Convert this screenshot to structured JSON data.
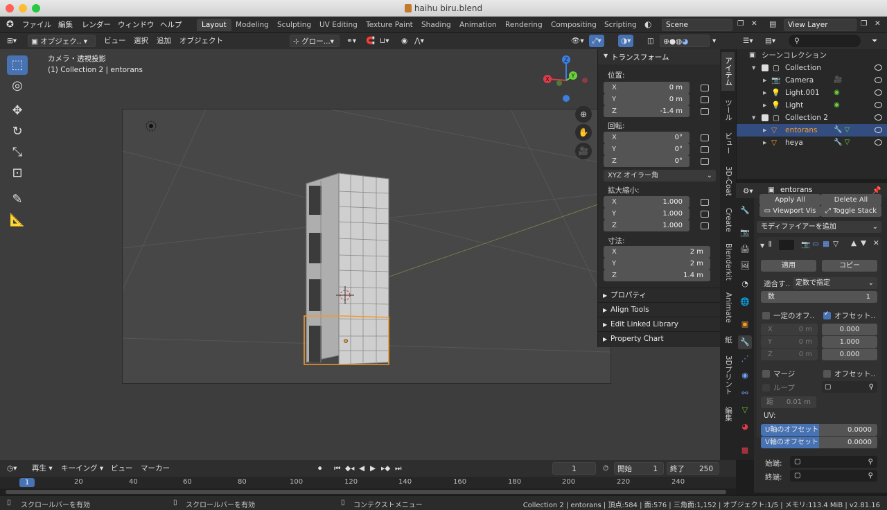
{
  "window": {
    "title": "haihu biru.blend"
  },
  "menu": [
    "ファイル",
    "編集",
    "レンダー",
    "ウィンドウ",
    "ヘルプ"
  ],
  "workspaces": [
    "Layout",
    "Modeling",
    "Sculpting",
    "UV Editing",
    "Texture Paint",
    "Shading",
    "Animation",
    "Rendering",
    "Compositing",
    "Scripting"
  ],
  "scene": {
    "label": "Scene"
  },
  "view_layer": {
    "label": "View Layer"
  },
  "viewport_header": {
    "mode": "オブジェク..",
    "view": "ビュー",
    "select": "選択",
    "add": "追加",
    "object": "オブジェクト",
    "orientation": "グロー..."
  },
  "viewport": {
    "view_name": "カメラ・透視投影",
    "collection_info": "(1) Collection 2 | entorans"
  },
  "gizmo": {
    "x": "X",
    "y": "Y",
    "z": "Z"
  },
  "transform": {
    "title": "トランスフォーム",
    "location_label": "位置:",
    "location": [
      {
        "axis": "X",
        "value": "0 m"
      },
      {
        "axis": "Y",
        "value": "0 m"
      },
      {
        "axis": "Z",
        "value": "-1.4 m"
      }
    ],
    "rotation_label": "回転:",
    "rotation": [
      {
        "axis": "X",
        "value": "0°"
      },
      {
        "axis": "Y",
        "value": "0°"
      },
      {
        "axis": "Z",
        "value": "0°"
      }
    ],
    "rotation_mode": "XYZ オイラー角",
    "scale_label": "拡大縮小:",
    "scale": [
      {
        "axis": "X",
        "value": "1.000"
      },
      {
        "axis": "Y",
        "value": "1.000"
      },
      {
        "axis": "Z",
        "value": "1.000"
      }
    ],
    "dimensions_label": "寸法:",
    "dimensions": [
      {
        "axis": "X",
        "value": "2 m"
      },
      {
        "axis": "Y",
        "value": "2 m"
      },
      {
        "axis": "Z",
        "value": "1.4 m"
      }
    ]
  },
  "npanel_sections": [
    "プロパティ",
    "Align Tools",
    "Edit Linked Library",
    "Property Chart"
  ],
  "npanel_tabs": [
    "アイテム",
    "ツール",
    "ビュー",
    "3D-Coat",
    "Create",
    "Blenderkit",
    "Animate",
    "紙",
    "3Dプリント",
    "編集"
  ],
  "outliner": {
    "root": "シーンコレクション",
    "rows": [
      {
        "name": "Collection",
        "indent": 1,
        "type": "collection"
      },
      {
        "name": "Camera",
        "indent": 2,
        "type": "camera"
      },
      {
        "name": "Light.001",
        "indent": 2,
        "type": "light"
      },
      {
        "name": "Light",
        "indent": 2,
        "type": "light"
      },
      {
        "name": "Collection 2",
        "indent": 1,
        "type": "collection"
      },
      {
        "name": "entorans",
        "indent": 2,
        "type": "mesh",
        "selected": true
      },
      {
        "name": "heya",
        "indent": 2,
        "type": "mesh"
      }
    ]
  },
  "properties": {
    "object_name": "entorans",
    "apply_all": "Apply All",
    "delete_all": "Delete All",
    "viewport_vis": "Viewport Vis",
    "toggle_stack": "Toggle Stack",
    "add_modifier": "モディファイアーを追加",
    "apply": "適用",
    "copy": "コピー",
    "fit_label": "適合す..",
    "fit_value": "定数で指定",
    "count_label": "数",
    "count_value": "1",
    "constant_offset": "一定のオフ..",
    "relative_offset": "オフセット..",
    "const_xyz": [
      {
        "axis": "X",
        "value": "0 m"
      },
      {
        "axis": "Y",
        "value": "0 m"
      },
      {
        "axis": "Z",
        "value": "0 m"
      }
    ],
    "rel_values": [
      "0.000",
      "1.000",
      "0.000"
    ],
    "merge": "マージ",
    "object_offset": "オフセット..",
    "loop": "ループ",
    "distance_label": "距",
    "distance_value": "0.01 m",
    "uv_label": "UV:",
    "u_offset_label": "U軸のオフセット",
    "u_offset_value": "0.0000",
    "v_offset_label": "V軸のオフセット",
    "v_offset_value": "0.0000",
    "start_cap": "始端:",
    "end_cap": "終端:"
  },
  "timeline": {
    "playback": "再生",
    "keying": "キーイング",
    "view": "ビュー",
    "marker": "マーカー",
    "current_frame": "1",
    "start_label": "開始",
    "start": "1",
    "end_label": "終了",
    "end": "250",
    "ruler": [
      "1",
      "20",
      "40",
      "60",
      "80",
      "100",
      "120",
      "140",
      "160",
      "180",
      "200",
      "220",
      "240"
    ]
  },
  "status": {
    "left": "スクロールバーを有効",
    "middle": "スクロールバーを有効",
    "right_hint": "コンテクストメニュー",
    "stats": "Collection 2 | entorans | 頂点:584 | 面:576 | 三角面:1,152 | オブジェクト:1/5 | メモリ:113.4 MiB | v2.81.16"
  },
  "colors": {
    "accent": "#4772b3",
    "selected_outline": "#f29a2e",
    "x_axis": "#e23a4a",
    "y_axis": "#6ad33c",
    "z_axis": "#3d7fe0"
  }
}
